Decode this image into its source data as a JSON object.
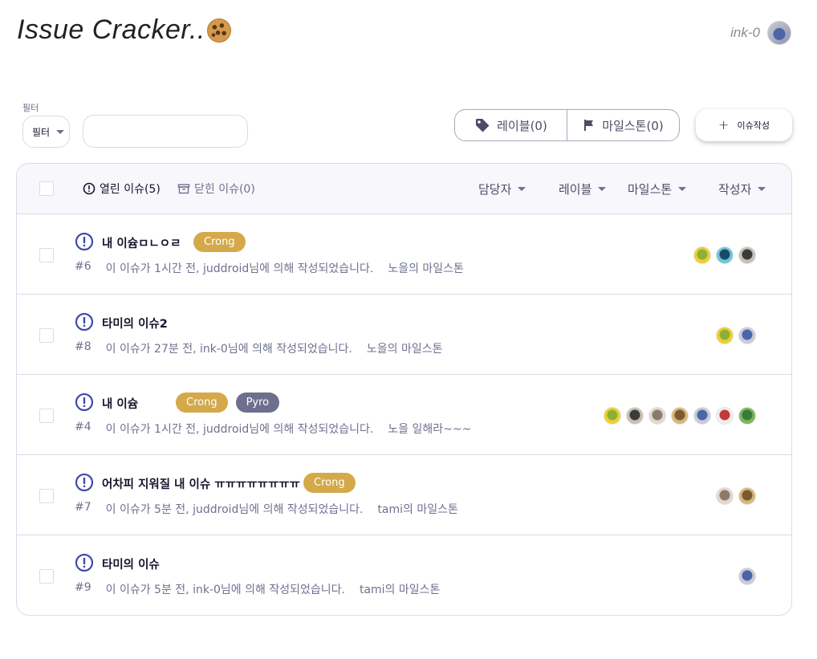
{
  "header": {
    "logo_text": "Issue Cracker..",
    "logo_icon": "cookie-icon",
    "user_name": "ink-0"
  },
  "toolbar": {
    "filter_caption": "필터",
    "filter_select_label": "필터",
    "search_placeholder": "",
    "labels_button": "레이블(0)",
    "milestones_button": "마일스톤(0)",
    "new_issue_button": "이슈작성"
  },
  "table": {
    "open_tab": "열린 이슈(5)",
    "closed_tab": "닫힌 이슈(0)",
    "filters": {
      "assignee": "담당자",
      "label": "레이블",
      "milestone": "마일스톤",
      "author": "작성자"
    },
    "rows": [
      {
        "title": "내 이슘ㅁㄴㅇㄹ",
        "labels": [
          {
            "name": "Crong",
            "color": "#d4a94a"
          }
        ],
        "number": "#6",
        "meta": "이 이슈가 1시간 전, juddroid님에 의해 작성되었습니다.",
        "milestone": "노을의 마일스톤",
        "assignees": [
          {
            "colors": [
              "#8bb03a",
              "#f0d02a"
            ]
          },
          {
            "colors": [
              "#1b4a68",
              "#6fc7d8"
            ]
          },
          {
            "colors": [
              "#3b3b3b",
              "#c9c0b4"
            ]
          }
        ]
      },
      {
        "title": "타미의 이슈2",
        "labels": [],
        "number": "#8",
        "meta": "이 이슈가 27분 전, ink-0님에 의해 작성되었습니다.",
        "milestone": "노을의 마일스톤",
        "assignees": [
          {
            "colors": [
              "#8bb03a",
              "#f0d02a"
            ]
          },
          {
            "colors": [
              "#4a66a8",
              "#c9cbd6"
            ]
          }
        ]
      },
      {
        "title": "내 이슘",
        "labels": [
          {
            "name": "Crong",
            "color": "#d4a94a"
          },
          {
            "name": "Pyro",
            "color": "#6e6f8f"
          }
        ],
        "number": "#4",
        "meta": "이 이슈가 1시간 전, juddroid님에 의해 작성되었습니다.",
        "milestone": "노을 일해라~~~",
        "assignees": [
          {
            "colors": [
              "#8bb03a",
              "#f0d02a"
            ]
          },
          {
            "colors": [
              "#3b3b3b",
              "#c9c0b4"
            ]
          },
          {
            "colors": [
              "#8a7a6a",
              "#e2d8cc"
            ]
          },
          {
            "colors": [
              "#7a5a30",
              "#d8b878"
            ]
          },
          {
            "colors": [
              "#4a66a8",
              "#c9cbd6"
            ]
          },
          {
            "colors": [
              "#c03a3a",
              "#f1eee9"
            ]
          },
          {
            "colors": [
              "#3c7a3a",
              "#7cb85a"
            ]
          }
        ]
      },
      {
        "title": "어차피 지워질 내 이슈 ㅠㅠㅠㅠㅠㅠㅠㅠ",
        "labels": [
          {
            "name": "Crong",
            "color": "#d4a94a"
          }
        ],
        "number": "#7",
        "meta": "이 이슈가 5분 전, juddroid님에 의해 작성되었습니다.",
        "milestone": "tami의 마일스톤",
        "assignees": [
          {
            "colors": [
              "#8a7a6a",
              "#e2d8cc"
            ]
          },
          {
            "colors": [
              "#7a5a30",
              "#d8b878"
            ]
          }
        ]
      },
      {
        "title": "타미의 이슈",
        "labels": [],
        "number": "#9",
        "meta": "이 이슈가 5분 전, ink-0님에 의해 작성되었습니다.",
        "milestone": "tami의 마일스톤",
        "assignees": [
          {
            "colors": [
              "#4a66a8",
              "#c9cbd6"
            ]
          }
        ]
      }
    ]
  },
  "colors": {
    "issue_open_icon": "#3f4ba8",
    "table_header_bg": "#f7f7fc",
    "border": "#d9dbe9"
  }
}
